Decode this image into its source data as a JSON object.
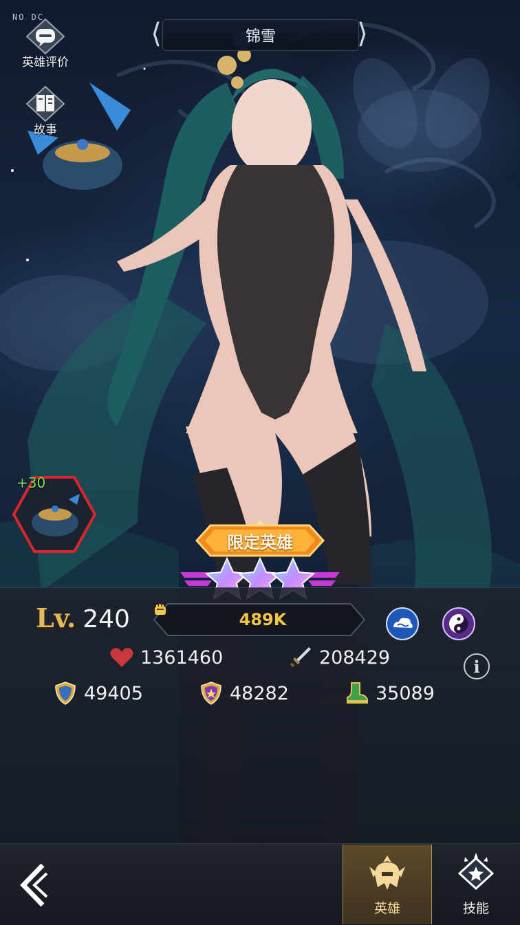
{
  "corner_tag": "NO DC",
  "header": {
    "hero_name": "锦雪"
  },
  "side_menu": [
    {
      "label": "英雄评价",
      "icon": "chat-bubble-icon"
    },
    {
      "label": "故事",
      "icon": "book-icon"
    }
  ],
  "artifact": {
    "bonus": "+30",
    "icon": "incense-burner-icon"
  },
  "badge": {
    "label": "限定英雄"
  },
  "stars": {
    "count": 3,
    "max": 3
  },
  "stats": {
    "level_prefix": "Lv.",
    "level": "240",
    "power": "489K",
    "hp": "1361460",
    "attack": "208429",
    "defense": "49405",
    "magic_defense": "48282",
    "speed": "35089"
  },
  "elements": [
    "cloud-icon",
    "yin-yang-icon"
  ],
  "bottom_nav": {
    "back": "back-arrow-icon",
    "tabs": [
      {
        "label": "英雄",
        "icon": "helmet-icon",
        "active": true
      },
      {
        "label": "技能",
        "icon": "skill-star-icon",
        "active": false
      }
    ]
  },
  "colors": {
    "accent_gold": "#e6b65a",
    "power_yellow": "#f5c54a",
    "bonus_green": "#7be05a",
    "artifact_border": "#d8262a"
  }
}
